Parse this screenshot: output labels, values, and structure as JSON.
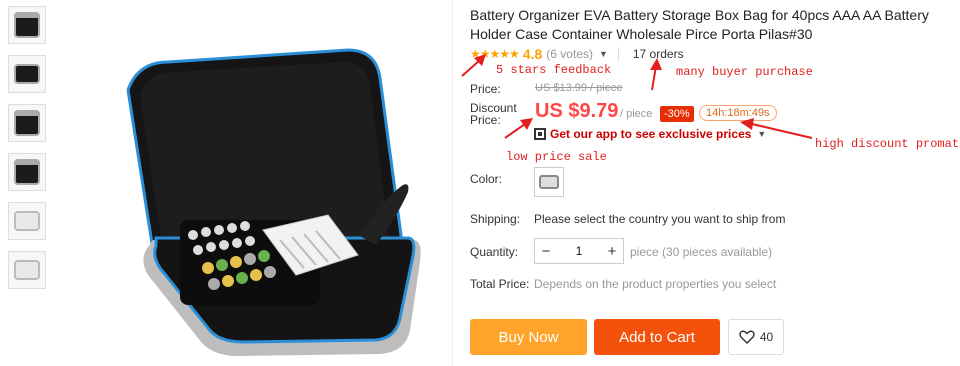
{
  "thumbnails": [
    "thumb-1",
    "thumb-2",
    "thumb-3",
    "thumb-4",
    "thumb-5",
    "thumb-6"
  ],
  "product": {
    "title": "Battery Organizer EVA Battery Storage Box Bag for 40pcs AAA AA Battery Holder Case Container Wholesale Pirce Porta Pilas#30",
    "stars": "★★★★★",
    "rating": "4.8",
    "votes": "(6 votes)",
    "orders": "17 orders"
  },
  "pricing": {
    "price_label": "Price:",
    "old_price": "US $13.99 / piece",
    "discount_label_1": "Discount",
    "discount_label_2": "Price:",
    "price": "US $9.79",
    "per": "/ piece",
    "discount": "-30%",
    "timer": "14h:18m:49s",
    "app_promo": "Get our app to see exclusive prices"
  },
  "options": {
    "color_label": "Color:",
    "shipping_label": "Shipping:",
    "shipping_text": "Please select the country you want to ship from",
    "quantity_label": "Quantity:",
    "quantity_value": "1",
    "quantity_minus": "−",
    "quantity_plus": "+",
    "quantity_available": "piece (30 pieces available)",
    "total_label": "Total Price:",
    "total_text": "Depends on the product properties you select"
  },
  "actions": {
    "buy_now": "Buy Now",
    "add_to_cart": "Add to Cart",
    "wishlist_count": "40"
  },
  "annotations": {
    "stars_feedback": "5 stars feedback",
    "buyer_purchase": "many buyer purchase",
    "low_price": "low price sale",
    "discount_promo": "high discount promation"
  },
  "colors": {
    "accent": "#ff4747",
    "buy": "#ffa32b",
    "cart": "#f4520c",
    "annotation": "#e21e1e",
    "stars": "#ffa200"
  }
}
